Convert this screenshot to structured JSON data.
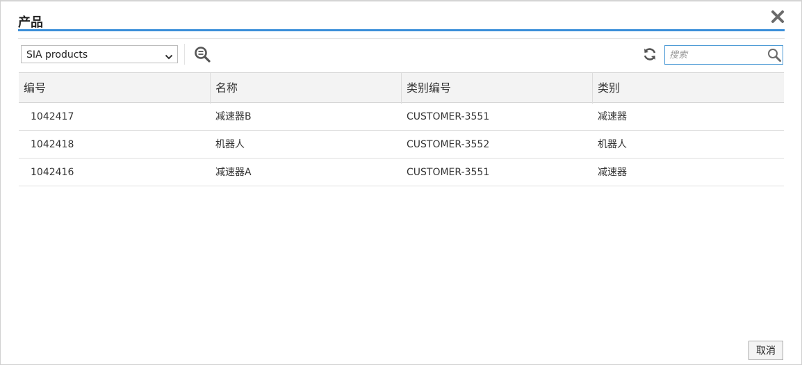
{
  "dialog": {
    "title": "产品",
    "close_icon": "close-icon",
    "cancel_label": "取消"
  },
  "toolbar": {
    "select": {
      "selected": "SIA products",
      "icon": "chevron-down-icon"
    },
    "zoom_icon": "zoom-filter-icon",
    "refresh_icon": "refresh-icon",
    "search": {
      "placeholder": "搜索",
      "value": "",
      "icon": "search-icon"
    }
  },
  "table": {
    "columns": [
      "编号",
      "名称",
      "类别编号",
      "类别"
    ],
    "rows": [
      [
        "1042417",
        "减速器B",
        "CUSTOMER-3551",
        "减速器"
      ],
      [
        "1042418",
        "机器人",
        "CUSTOMER-3552",
        "机器人"
      ],
      [
        "1042416",
        "减速器A",
        "CUSTOMER-3551",
        "减速器"
      ]
    ]
  },
  "colors": {
    "accent": "#3b8fd9",
    "search_border": "#4e9bd6",
    "header_bg": "#f3f3f3",
    "icon_gray": "#555555"
  }
}
